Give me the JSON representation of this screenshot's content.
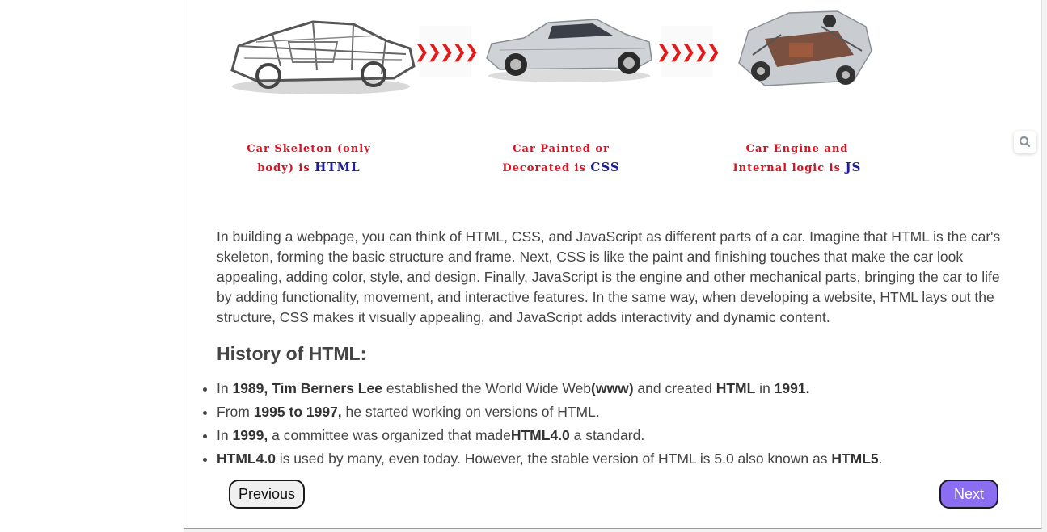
{
  "diagram": {
    "arrow_glyph": "❯❯❯❯❯",
    "captions": [
      {
        "line1": "Car Skeleton (only",
        "line2_prefix": "body) is ",
        "highlight": "HTML"
      },
      {
        "line1": "Car Painted or",
        "line2_prefix": "Decorated is ",
        "highlight": "CSS"
      },
      {
        "line1": "Car Engine and",
        "line2_prefix": "Internal logic is ",
        "highlight": "JS"
      }
    ]
  },
  "main": {
    "paragraph": "In building a webpage, you can think of HTML, CSS, and JavaScript as different parts of a car. Imagine that HTML is the car's skeleton, forming the basic structure and frame. Next, CSS is like the paint and finishing touches that make the car look appealing, adding color, style, and design. Finally, JavaScript is the engine and other mechanical parts, bringing the car to life by adding functionality, movement, and interactive features. In the same way, when developing a website, HTML lays out the structure, CSS makes it visually appealing, and JavaScript adds interactivity and dynamic content.",
    "history_heading": "History of HTML:",
    "history": [
      {
        "t1": "In ",
        "b1": "1989, Tim Berners Lee",
        "t2": " established the World Wide Web",
        "b2": "(www)",
        "t3": " and created ",
        "b3": "HTML",
        "t4": " in ",
        "b4": "1991."
      },
      {
        "t1": "From ",
        "b1": "1995 to 1997,",
        "t2": " he started working on versions of HTML."
      },
      {
        "t1": "In ",
        "b1": "1999,",
        "t2": " a committee was organized that made",
        "b2": "HTML4.0",
        "t3": " a standard."
      },
      {
        "b1": "HTML4.0",
        "t1": " is used by many, even today. However, the stable version of HTML is 5.0 also known as ",
        "b2": "HTML5",
        "t2": "."
      }
    ]
  },
  "nav": {
    "previous_label": "Previous",
    "next_label": "Next"
  },
  "colors": {
    "accent": "#8a6df0",
    "caption_red": "#e01020",
    "caption_blue": "#1d1d9c",
    "arrow_red": "#e41b1b"
  },
  "icons": {
    "floating_tool": "search-icon"
  }
}
